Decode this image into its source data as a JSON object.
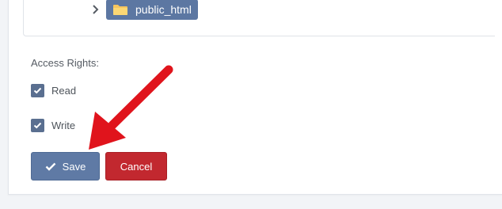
{
  "tree": {
    "folder_label": "public_html",
    "folder_icon": "folder-icon",
    "expand_icon": "chevron-right-icon"
  },
  "access": {
    "section_label": "Access Rights:",
    "read_label": "Read",
    "read_checked": true,
    "write_label": "Write",
    "write_checked": true
  },
  "actions": {
    "save_label": "Save",
    "save_icon": "checkmark-icon",
    "cancel_label": "Cancel"
  },
  "colors": {
    "primary": "#5f7aa5",
    "danger": "#c2282f",
    "annotation": "#e0141c"
  }
}
